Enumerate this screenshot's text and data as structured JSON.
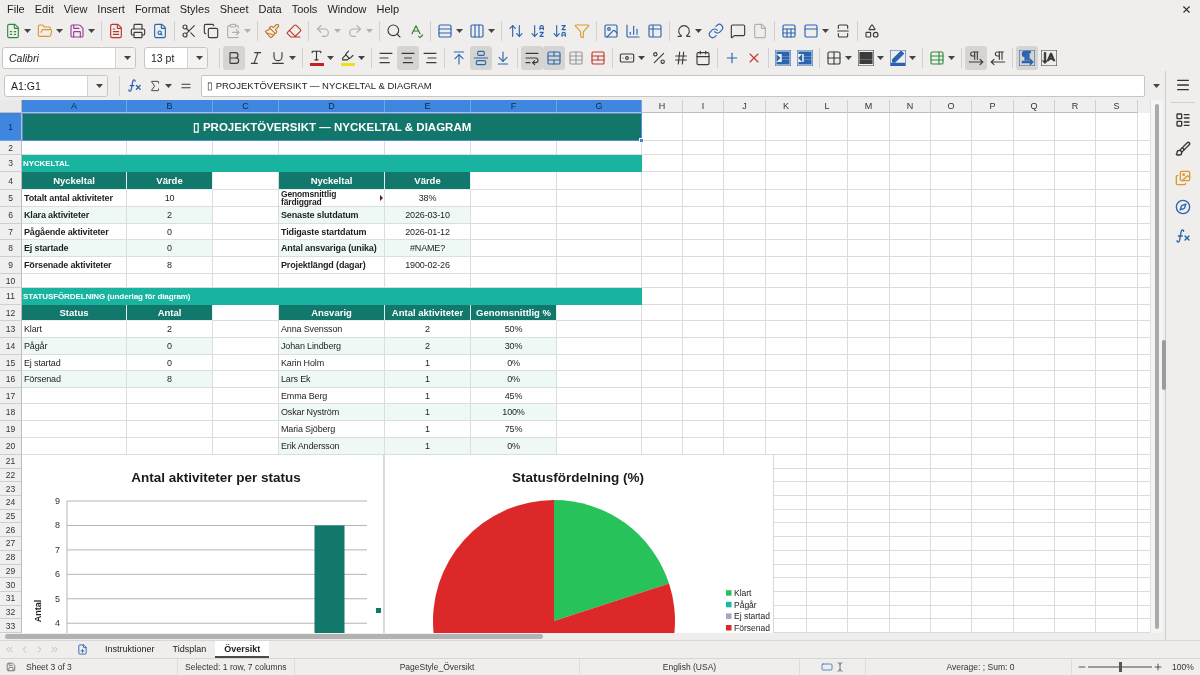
{
  "menu": [
    "File",
    "Edit",
    "View",
    "Insert",
    "Format",
    "Styles",
    "Sheet",
    "Data",
    "Tools",
    "Window",
    "Help"
  ],
  "standard_toolbar": {
    "paste_disabled": true,
    "undo_disabled": true,
    "redo_disabled": true,
    "headers_footers_disabled": true
  },
  "format_toolbar": {
    "font_name": "Calibri",
    "font_size": "13 pt",
    "bold": true,
    "italic": false,
    "underline": false,
    "align_left": false,
    "align_center": true,
    "align_right": false,
    "align_top": false,
    "align_middle": true,
    "align_bottom": false,
    "wrap_text": true,
    "merge_and_center": true,
    "left_to_right": true,
    "right_to_left": false,
    "text_left_to_right": true,
    "text_top_to_bottom": false
  },
  "formula_bar": {
    "name_box": "A1:G1",
    "content": "▯ PROJEKTÖVERSIKT — NYCKELTAL & DIAGRAM"
  },
  "sheet": {
    "columns": [
      {
        "label": "A",
        "selected": true
      },
      {
        "label": "B",
        "selected": true
      },
      {
        "label": "C",
        "selected": true
      },
      {
        "label": "D",
        "selected": true
      },
      {
        "label": "E",
        "selected": true
      },
      {
        "label": "F",
        "selected": true
      },
      {
        "label": "G",
        "selected": true
      },
      {
        "label": "H",
        "selected": false
      },
      {
        "label": "I",
        "selected": false
      },
      {
        "label": "J",
        "selected": false
      },
      {
        "label": "K",
        "selected": false
      },
      {
        "label": "L",
        "selected": false
      },
      {
        "label": "M",
        "selected": false
      },
      {
        "label": "N",
        "selected": false
      },
      {
        "label": "O",
        "selected": false
      },
      {
        "label": "P",
        "selected": false
      },
      {
        "label": "Q",
        "selected": false
      },
      {
        "label": "R",
        "selected": false
      },
      {
        "label": "S",
        "selected": false
      }
    ],
    "rows": [
      {
        "label": "1",
        "selected": true
      },
      {
        "label": "2",
        "selected": false
      },
      {
        "label": "3",
        "selected": false
      },
      {
        "label": "4",
        "selected": false
      },
      {
        "label": "5",
        "selected": false
      },
      {
        "label": "6",
        "selected": false
      },
      {
        "label": "7",
        "selected": false
      },
      {
        "label": "8",
        "selected": false
      },
      {
        "label": "9",
        "selected": false
      },
      {
        "label": "10",
        "selected": false
      },
      {
        "label": "11",
        "selected": false
      },
      {
        "label": "12",
        "selected": false
      },
      {
        "label": "13",
        "selected": false
      },
      {
        "label": "14",
        "selected": false
      },
      {
        "label": "15",
        "selected": false
      },
      {
        "label": "16",
        "selected": false
      },
      {
        "label": "17",
        "selected": false
      },
      {
        "label": "18",
        "selected": false
      },
      {
        "label": "19",
        "selected": false
      },
      {
        "label": "20",
        "selected": false
      },
      {
        "label": "21",
        "selected": false
      },
      {
        "label": "22",
        "selected": false
      },
      {
        "label": "23",
        "selected": false
      },
      {
        "label": "24",
        "selected": false
      },
      {
        "label": "25",
        "selected": false
      },
      {
        "label": "26",
        "selected": false
      },
      {
        "label": "27",
        "selected": false
      },
      {
        "label": "28",
        "selected": false
      },
      {
        "label": "29",
        "selected": false
      },
      {
        "label": "30",
        "selected": false
      },
      {
        "label": "31",
        "selected": false
      },
      {
        "label": "32",
        "selected": false
      },
      {
        "label": "33",
        "selected": false
      }
    ],
    "title": "▯ PROJEKTÖVERSIKT — NYCKELTAL & DIAGRAM",
    "sections": [
      {
        "heading": "NYCKELTAL",
        "tables": [
          {
            "kind": "kpi",
            "columns": [
              "Nyckeltal",
              "Värde"
            ],
            "rows": [
              {
                "cells": [
                  "Totalt antal aktiviteter",
                  "10"
                ]
              },
              {
                "cells": [
                  "Klara aktiviteter",
                  "2"
                ]
              },
              {
                "cells": [
                  "Pågående aktiviteter",
                  "0"
                ]
              },
              {
                "cells": [
                  "Ej startade",
                  "0"
                ]
              },
              {
                "cells": [
                  "Försenade aktiviteter",
                  "8"
                ]
              }
            ]
          },
          {
            "kind": "kpi",
            "columns": [
              "Nyckeltal",
              "Värde"
            ],
            "rows": [
              {
                "cells": [
                  "Genomsnittlig färdiggrad",
                  "38%"
                ],
                "overflow": true
              },
              {
                "cells": [
                  "Senaste slutdatum",
                  "2026-03-10"
                ],
                "overflow": false
              },
              {
                "cells": [
                  "Tidigaste startdatum",
                  "2026-01-12"
                ],
                "overflow": false
              },
              {
                "cells": [
                  "Antal ansvariga (unika)",
                  "#NAME?"
                ],
                "overflow": false
              },
              {
                "cells": [
                  "Projektlängd (dagar)",
                  "1900-02-26"
                ],
                "overflow": false
              }
            ]
          }
        ]
      },
      {
        "heading": "STATUSFÖRDELNING (underlag för diagram)",
        "tables": [
          {
            "kind": "list",
            "columns": [
              "Status",
              "Antal"
            ],
            "rows": [
              {
                "cells": [
                  "Klart",
                  "2"
                ]
              },
              {
                "cells": [
                  "Pågår",
                  "0"
                ]
              },
              {
                "cells": [
                  "Ej startad",
                  "0"
                ]
              },
              {
                "cells": [
                  "Försenad",
                  "8"
                ]
              }
            ]
          },
          {
            "kind": "list",
            "columns": [
              "Ansvarig",
              "Antal aktiviteter",
              "Genomsnittlig %"
            ],
            "rows": [
              {
                "cells": [
                  "Anna Svensson",
                  "2",
                  "50%"
                ]
              },
              {
                "cells": [
                  "Johan Lindberg",
                  "2",
                  "30%"
                ]
              },
              {
                "cells": [
                  "Karin Holm",
                  "1",
                  "0%"
                ]
              },
              {
                "cells": [
                  "Lars Ek",
                  "1",
                  "0%"
                ]
              },
              {
                "cells": [
                  "Emma Berg",
                  "1",
                  "45%"
                ]
              },
              {
                "cells": [
                  "Oskar Nyström",
                  "1",
                  "100%"
                ]
              },
              {
                "cells": [
                  "Maria Sjöberg",
                  "1",
                  "75%"
                ]
              },
              {
                "cells": [
                  "Erik Andersson",
                  "1",
                  "0%"
                ]
              }
            ]
          }
        ]
      }
    ],
    "charts": [
      {
        "chart_data": {
          "type": "bar",
          "title": "Antal aktiviteter per status",
          "ylabel": "Antal",
          "series": [
            {
              "color": "#13786c",
              "values": [
                null,
                null,
                null,
                8
              ]
            }
          ],
          "ylim": [
            3.6,
            9
          ],
          "yticks": [
            4,
            5,
            6,
            7,
            8,
            9
          ],
          "grid": true
        }
      },
      {
        "chart_data": {
          "type": "pie",
          "title": "Statusfördelning (%)",
          "categories": [
            "Klart",
            "Pågår",
            "Ej startad",
            "Försenad"
          ],
          "values": [
            20,
            0,
            0,
            80
          ],
          "colors": [
            "#28c25b",
            "#1bb8a5",
            "#a2a6c4",
            "#dc2828"
          ],
          "legend": "right"
        }
      }
    ]
  },
  "sheet_tabs": {
    "nav_disabled": true,
    "tabs": [
      {
        "label": "Instruktioner",
        "selected": false
      },
      {
        "label": "Tidsplan",
        "selected": false
      },
      {
        "label": "Översikt",
        "selected": true
      }
    ]
  },
  "status_bar": {
    "sheet": "Sheet 3 of 3",
    "selection": "Selected: 1 row, 7 columns",
    "page_style": "PageStyle_Översikt",
    "language": "English (USA)",
    "summary": "Average: ; Sum: 0",
    "zoom": {
      "level": 0.5,
      "reading": "100%"
    }
  }
}
